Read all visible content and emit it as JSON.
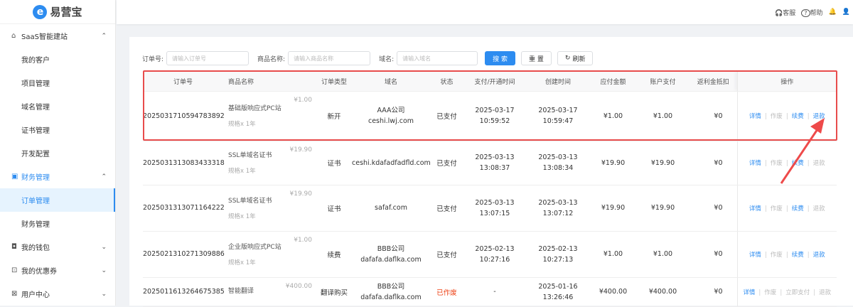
{
  "brand": {
    "logo_letter": "e",
    "name": "易营宝"
  },
  "sidebar": {
    "items": [
      {
        "label": "SaaS智能建站",
        "icon": "home-icon",
        "type": "group",
        "chev": "^"
      },
      {
        "label": "我的客户",
        "type": "sub"
      },
      {
        "label": "项目管理",
        "type": "sub"
      },
      {
        "label": "域名管理",
        "type": "sub"
      },
      {
        "label": "证书管理",
        "type": "sub"
      },
      {
        "label": "开发配置",
        "type": "sub"
      },
      {
        "label": "财务管理",
        "icon": "finance-icon",
        "type": "group",
        "chev": "^",
        "blue": true
      },
      {
        "label": "订单管理",
        "type": "sub",
        "active": true
      },
      {
        "label": "财务管理",
        "type": "sub"
      },
      {
        "label": "我的钱包",
        "icon": "wallet-icon",
        "type": "group",
        "chev": "v"
      },
      {
        "label": "我的优惠券",
        "icon": "coupon-icon",
        "type": "group",
        "chev": "v"
      },
      {
        "label": "用户中心",
        "icon": "user-center-icon",
        "type": "group",
        "chev": "v"
      }
    ]
  },
  "header": {
    "service": "客服",
    "help": "帮助"
  },
  "filters": {
    "order_label": "订单号:",
    "order_placeholder": "请输入订单号",
    "product_label": "商品名称:",
    "product_placeholder": "请输入商品名称",
    "domain_label": "域名:",
    "domain_placeholder": "请输入域名",
    "search": "搜 索",
    "reset": "重 置",
    "refresh": "刷新"
  },
  "table": {
    "columns": [
      "订单号",
      "商品名称",
      "订单类型",
      "域名",
      "状态",
      "支付/开通时间",
      "创建时间",
      "应付金额",
      "账户支付",
      "返利金抵扣",
      "操作"
    ],
    "rows": [
      {
        "order": "2025031710594783892",
        "product": "基础版响应式PC站",
        "spec": "规格x 1年",
        "price": "¥1.00",
        "type": "新开",
        "company": "AAA公司",
        "domain": "ceshi.lwj.com",
        "status": "已支付",
        "pay_date": "2025-03-17",
        "pay_time": "10:59:52",
        "create_date": "2025-03-17",
        "create_time": "10:59:47",
        "due": "¥1.00",
        "account": "¥1.00",
        "rebate": "¥0",
        "ops": [
          {
            "l": "详情",
            "on": true
          },
          {
            "l": "作废",
            "on": false
          },
          {
            "l": "续费",
            "on": true
          },
          {
            "l": "退款",
            "on": true
          }
        ]
      },
      {
        "order": "2025031313083433318",
        "product": "SSL单域名证书",
        "spec": "规格x 1年",
        "price": "¥19.90",
        "type": "证书",
        "company": "",
        "domain": "ceshi.kdafadfadfld.com",
        "status": "已支付",
        "pay_date": "2025-03-13",
        "pay_time": "13:08:37",
        "create_date": "2025-03-13",
        "create_time": "13:08:34",
        "due": "¥19.90",
        "account": "¥19.90",
        "rebate": "¥0",
        "ops": [
          {
            "l": "详情",
            "on": true
          },
          {
            "l": "作废",
            "on": false
          },
          {
            "l": "续费",
            "on": true
          },
          {
            "l": "退款",
            "on": false
          }
        ]
      },
      {
        "order": "2025031313071164222",
        "product": "SSL单域名证书",
        "spec": "规格x 1年",
        "price": "¥19.90",
        "type": "证书",
        "company": "",
        "domain": "safaf.com",
        "status": "已支付",
        "pay_date": "2025-03-13",
        "pay_time": "13:07:15",
        "create_date": "2025-03-13",
        "create_time": "13:07:12",
        "due": "¥19.90",
        "account": "¥19.90",
        "rebate": "¥0",
        "ops": [
          {
            "l": "详情",
            "on": true
          },
          {
            "l": "作废",
            "on": false
          },
          {
            "l": "续费",
            "on": true
          },
          {
            "l": "退款",
            "on": false
          }
        ]
      },
      {
        "order": "2025021310271309886",
        "product": "企业版响应式PC站",
        "spec": "规格x 1年",
        "price": "¥1.00",
        "type": "续费",
        "company": "BBB公司",
        "domain": "dafafa.daflka.com",
        "status": "已支付",
        "pay_date": "2025-02-13",
        "pay_time": "10:27:16",
        "create_date": "2025-02-13",
        "create_time": "10:27:13",
        "due": "¥1.00",
        "account": "¥1.00",
        "rebate": "¥0",
        "ops": [
          {
            "l": "详情",
            "on": true
          },
          {
            "l": "作废",
            "on": false
          },
          {
            "l": "续费",
            "on": true
          },
          {
            "l": "退款",
            "on": true
          }
        ]
      },
      {
        "order": "2025011613264675385",
        "product": "智能翻译",
        "spec": "",
        "price": "¥400.00",
        "type": "翻译购买",
        "company": "BBB公司",
        "domain": "dafafa.daflka.com",
        "status": "已作废",
        "pay_date": "-",
        "pay_time": "",
        "create_date": "2025-01-16",
        "create_time": "13:26:46",
        "due": "¥400.00",
        "account": "¥400.00",
        "rebate": "¥0",
        "ops": [
          {
            "l": "详情",
            "on": true
          },
          {
            "l": "作废",
            "on": false
          },
          {
            "l": "立即支付",
            "on": false
          },
          {
            "l": "退款",
            "on": false
          }
        ]
      }
    ]
  },
  "colors": {
    "accent": "#2d8cf0",
    "highlight": "#e84c4c",
    "void": "#ed4014"
  }
}
